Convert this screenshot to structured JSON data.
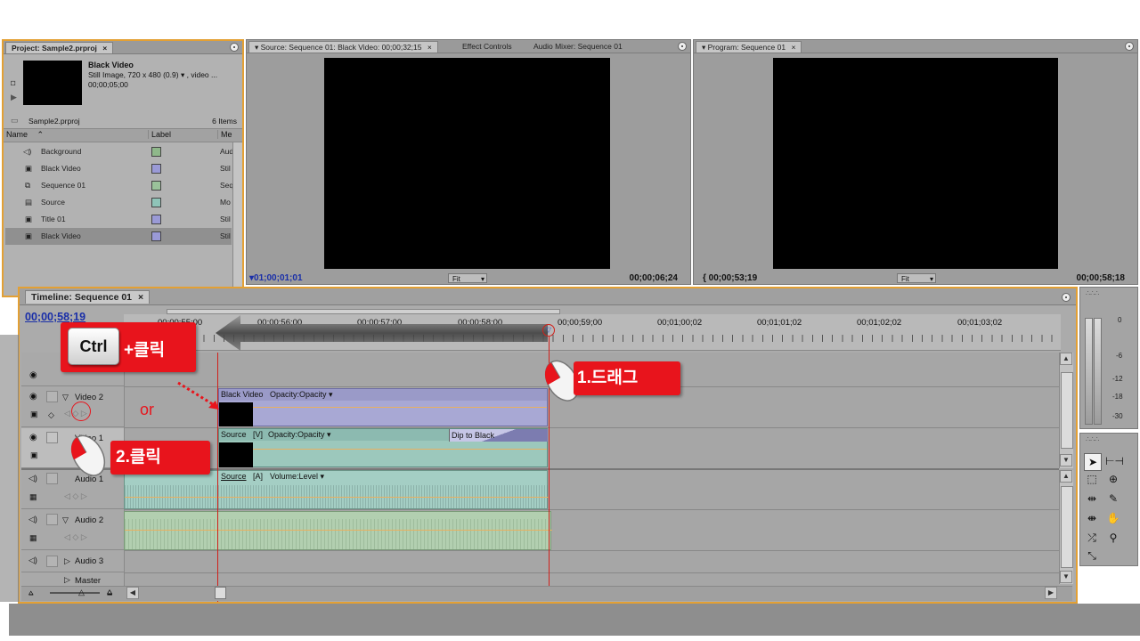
{
  "project": {
    "tab_title": "Project: Sample2.prproj",
    "clip_name": "Black Video",
    "clip_info": "Still Image, 720 x 480 (0.9)",
    "clip_info_suffix": ", video ...",
    "clip_duration": "00;00;05;00",
    "file_name": "Sample2.prproj",
    "items_count": "6 Items",
    "columns": [
      "Name",
      "Label",
      "Me"
    ],
    "items": [
      {
        "name": "Background",
        "media": "Aud",
        "color": "#8fb88a"
      },
      {
        "name": "Black Video",
        "media": "Stil",
        "color": "#9a9ad6"
      },
      {
        "name": "Sequence 01",
        "media": "Seq",
        "color": "#9ac29a"
      },
      {
        "name": "Source",
        "media": "Mo",
        "color": "#8fc4b8"
      },
      {
        "name": "Title 01",
        "media": "Stil",
        "color": "#9a9ad6"
      },
      {
        "name": "Black Video",
        "media": "Stil",
        "color": "#9a9ad6"
      }
    ]
  },
  "source_monitor": {
    "tabs": [
      "Source: Sequence 01: Black Video: 00;00;32;15",
      "Effect Controls",
      "Audio Mixer: Sequence 01"
    ],
    "timecode_left": "01;00;01;01",
    "fit": "Fit",
    "timecode_right": "00;00;06;24"
  },
  "program_monitor": {
    "tab": "Program: Sequence 01",
    "timecode_left": "00;00;53;19",
    "fit": "Fit",
    "timecode_right": "00;00;58;18"
  },
  "timeline": {
    "tab_title": "Timeline: Sequence 01",
    "current_time": "00;00;58;19",
    "ruler": [
      "00;00;55;00",
      "00;00;56;00",
      "00;00;57;00",
      "00;00;58;00",
      "00;00;59;00",
      "00;01;00;02",
      "00;01;01;02",
      "00;01;02;02",
      "00;01;03;02"
    ],
    "tracks": {
      "video2": "Video 2",
      "video1": "Video 1",
      "audio1": "Audio 1",
      "audio2": "Audio 2",
      "audio3": "Audio 3",
      "master": "Master"
    },
    "clips": {
      "v2_name": "Black Video",
      "v2_effect": "Opacity:Opacity",
      "v1_name": "Source",
      "v1_tag": "[V]",
      "v1_effect": "Opacity:Opacity",
      "v1_transition": "Dip to Black",
      "a1_name": "Source",
      "a1_tag": "[A]",
      "a1_effect": "Volume:Level"
    }
  },
  "audio_meter": {
    "ticks": [
      "0",
      "-6",
      "-12",
      "-18",
      "-30"
    ]
  },
  "annotations": {
    "ctrl_key": "Ctrl",
    "ctrl_click": "+클릭",
    "or": "or",
    "drag": "1.드래그",
    "click": "2.클릭"
  },
  "colors": {
    "highlight": "#e3a034",
    "callout": "#e8141c",
    "timecode": "#1a2fa8",
    "video_clip": "#a8a8d4",
    "source_clip": "#9cc8bc",
    "audio_clip": "#a8c8a8"
  }
}
